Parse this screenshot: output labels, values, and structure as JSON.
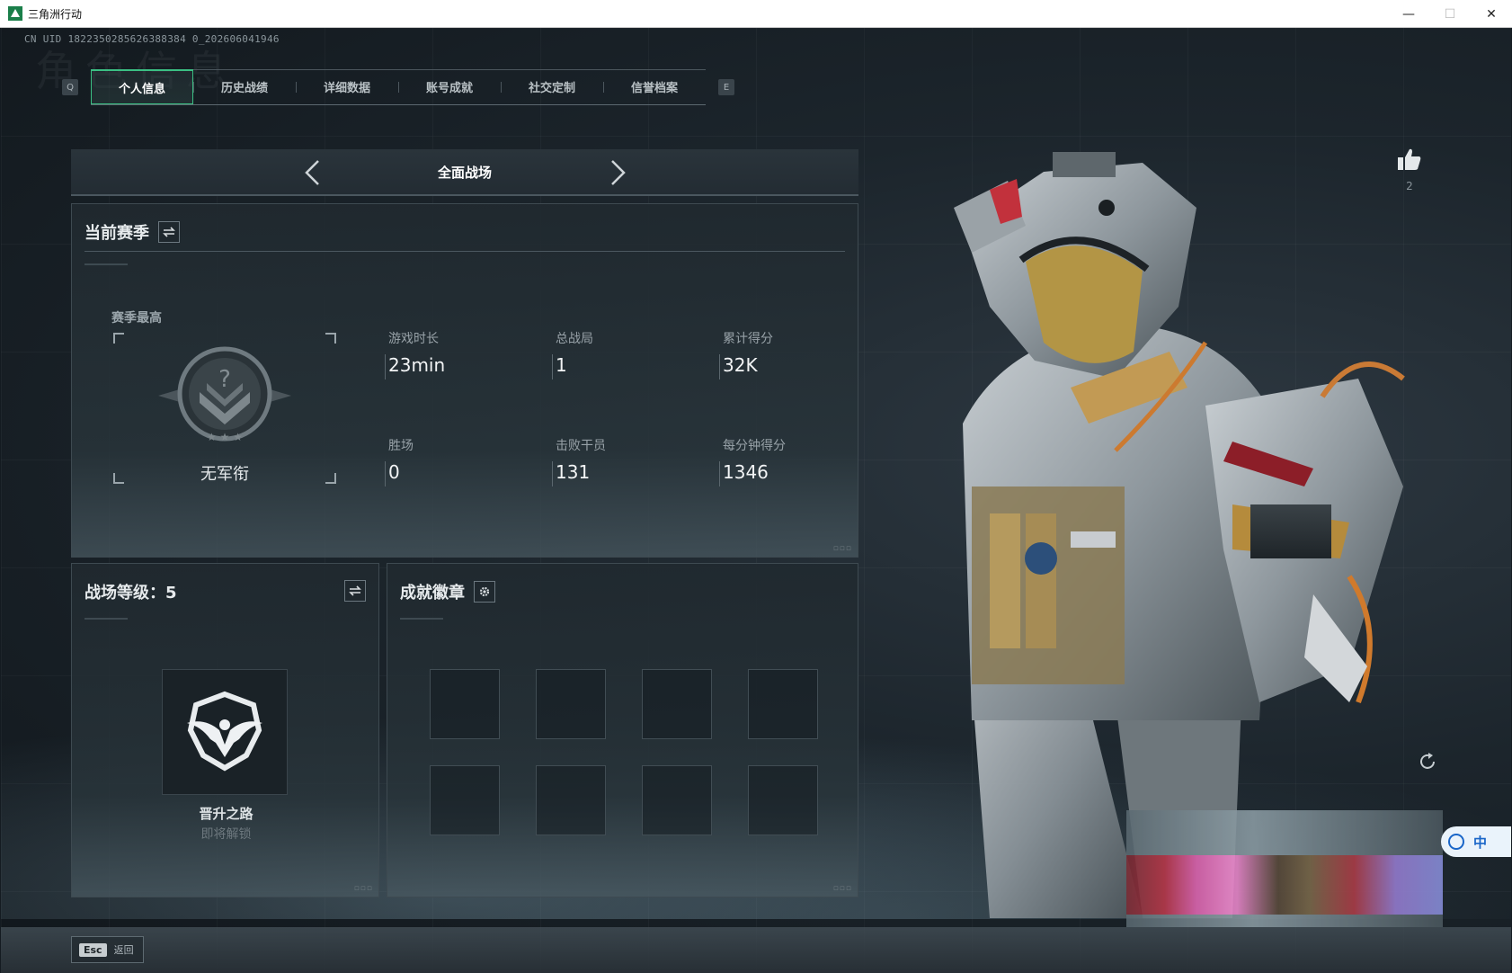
{
  "window": {
    "title": "三角洲行动",
    "minimize_glyph": "—",
    "maximize_glyph": "☐",
    "close_glyph": "✕"
  },
  "header": {
    "uid": "CN UID 1822350285626388384 0_202606041946",
    "ghost_title": "角色信息"
  },
  "tabs": {
    "left_key": "Q",
    "right_key": "E",
    "items": [
      {
        "label": "个人信息",
        "active": true
      },
      {
        "label": "历史战绩",
        "active": false
      },
      {
        "label": "详细数据",
        "active": false
      },
      {
        "label": "账号成就",
        "active": false
      },
      {
        "label": "社交定制",
        "active": false
      },
      {
        "label": "信誉档案",
        "active": false
      }
    ]
  },
  "mode": {
    "title": "全面战场"
  },
  "season": {
    "title": "当前赛季",
    "rank_label": "赛季最高",
    "rank_name": "无军衔",
    "stats": [
      {
        "label": "游戏时长",
        "value": "23min"
      },
      {
        "label": "总战局",
        "value": "1"
      },
      {
        "label": "累计得分",
        "value": "32K"
      },
      {
        "label": "胜场",
        "value": "0"
      },
      {
        "label": "击败干员",
        "value": "131"
      },
      {
        "label": "每分钟得分",
        "value": "1346"
      }
    ]
  },
  "level": {
    "title": "战场等级：5",
    "medal_name": "晋升之路",
    "medal_status": "即将解锁"
  },
  "badges": {
    "title": "成就徽章",
    "slot_count": 8
  },
  "social": {
    "like_count": "2"
  },
  "ime": {
    "label": "中"
  },
  "footer": {
    "esc_key": "Esc",
    "esc_label": "返回"
  },
  "colors": {
    "accent": "#3bbf83",
    "panel": "#232c33",
    "text": "#e6eaec"
  }
}
